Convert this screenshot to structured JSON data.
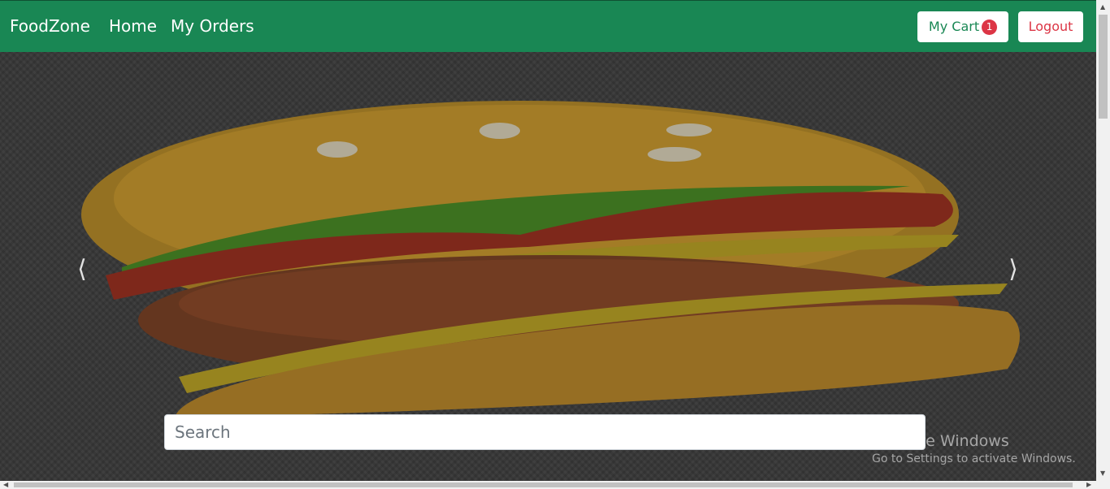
{
  "navbar": {
    "brand": "FoodZone",
    "links": [
      "Home",
      "My Orders"
    ],
    "cart_label": "My Cart",
    "cart_count": "1",
    "logout_label": "Logout",
    "bg_color": "#198754"
  },
  "carousel": {
    "prev_icon": "chevron-left-icon",
    "next_icon": "chevron-right-icon"
  },
  "search": {
    "placeholder": "Search"
  },
  "watermark": {
    "title": "Activate Windows",
    "subtitle": "Go to Settings to activate Windows."
  }
}
